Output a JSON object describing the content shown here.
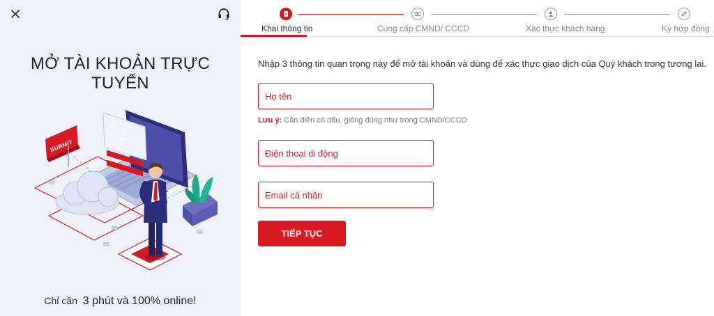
{
  "left_panel": {
    "close_icon": "close-icon",
    "support_icon": "headset-icon",
    "title": "MỞ TÀI KHOẢN TRỰC TUYẾN",
    "illustration_submit_label": "SUBMIT",
    "footer_prefix": "Chỉ cần",
    "footer_highlight": "3 phút và 100% online!"
  },
  "stepper": {
    "steps": [
      {
        "label": "Khai thông tin",
        "icon": "document-icon",
        "active": true
      },
      {
        "label": "Cung cấp CMND/ CCCD",
        "icon": "id-card-icon",
        "active": false
      },
      {
        "label": "Xác thực khách hàng",
        "icon": "user-icon",
        "active": false
      },
      {
        "label": "Ký hợp đồng",
        "icon": "pen-icon",
        "active": false
      }
    ]
  },
  "form": {
    "intro": "Nhập 3 thông tin quan trọng này để mở tài khoản và dùng để xác thực giao dịch của Quý khách trong tương lai.",
    "name_placeholder": "Họ tên",
    "note_label": "Lưu ý:",
    "note_text": "Cần điền có dấu, giống đúng như trong CMND/CCCD",
    "phone_placeholder": "Điện thoại di động",
    "email_placeholder": "Email cá nhân",
    "submit_label": "TIẾP TỤC"
  },
  "colors": {
    "accent": "#d71920",
    "left_panel_bg": "#eef1f8",
    "inactive_step": "#9a9a9a"
  }
}
